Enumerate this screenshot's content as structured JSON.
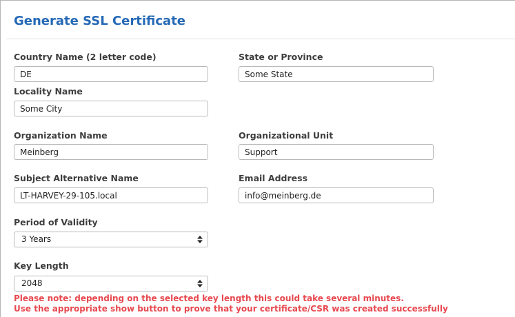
{
  "title": "Generate SSL Certificate",
  "fields": {
    "country": {
      "label": "Country Name (2 letter code)",
      "value": "DE"
    },
    "state": {
      "label": "State or Province",
      "value": "Some State"
    },
    "locality": {
      "label": "Locality Name",
      "value": "Some City"
    },
    "organization": {
      "label": "Organization Name",
      "value": "Meinberg"
    },
    "org_unit": {
      "label": "Organizational Unit",
      "value": "Support"
    },
    "san": {
      "label": "Subject Alternative Name",
      "value": "LT-HARVEY-29-105.local"
    },
    "email": {
      "label": "Email Address",
      "value": "info@meinberg.de"
    },
    "validity": {
      "label": "Period of Validity",
      "value": "3 Years",
      "icon": "updown-arrows-icon"
    },
    "key_length": {
      "label": "Key Length",
      "value": "2048",
      "icon": "updown-arrows-icon"
    }
  },
  "notes": {
    "line1": "Please note: depending on the selected key length this could take several minutes.",
    "line2": "Use the appropriate show button to prove that your certificate/CSR was created successfully"
  },
  "colors": {
    "title": "#2569b6",
    "note": "#e8484f"
  }
}
